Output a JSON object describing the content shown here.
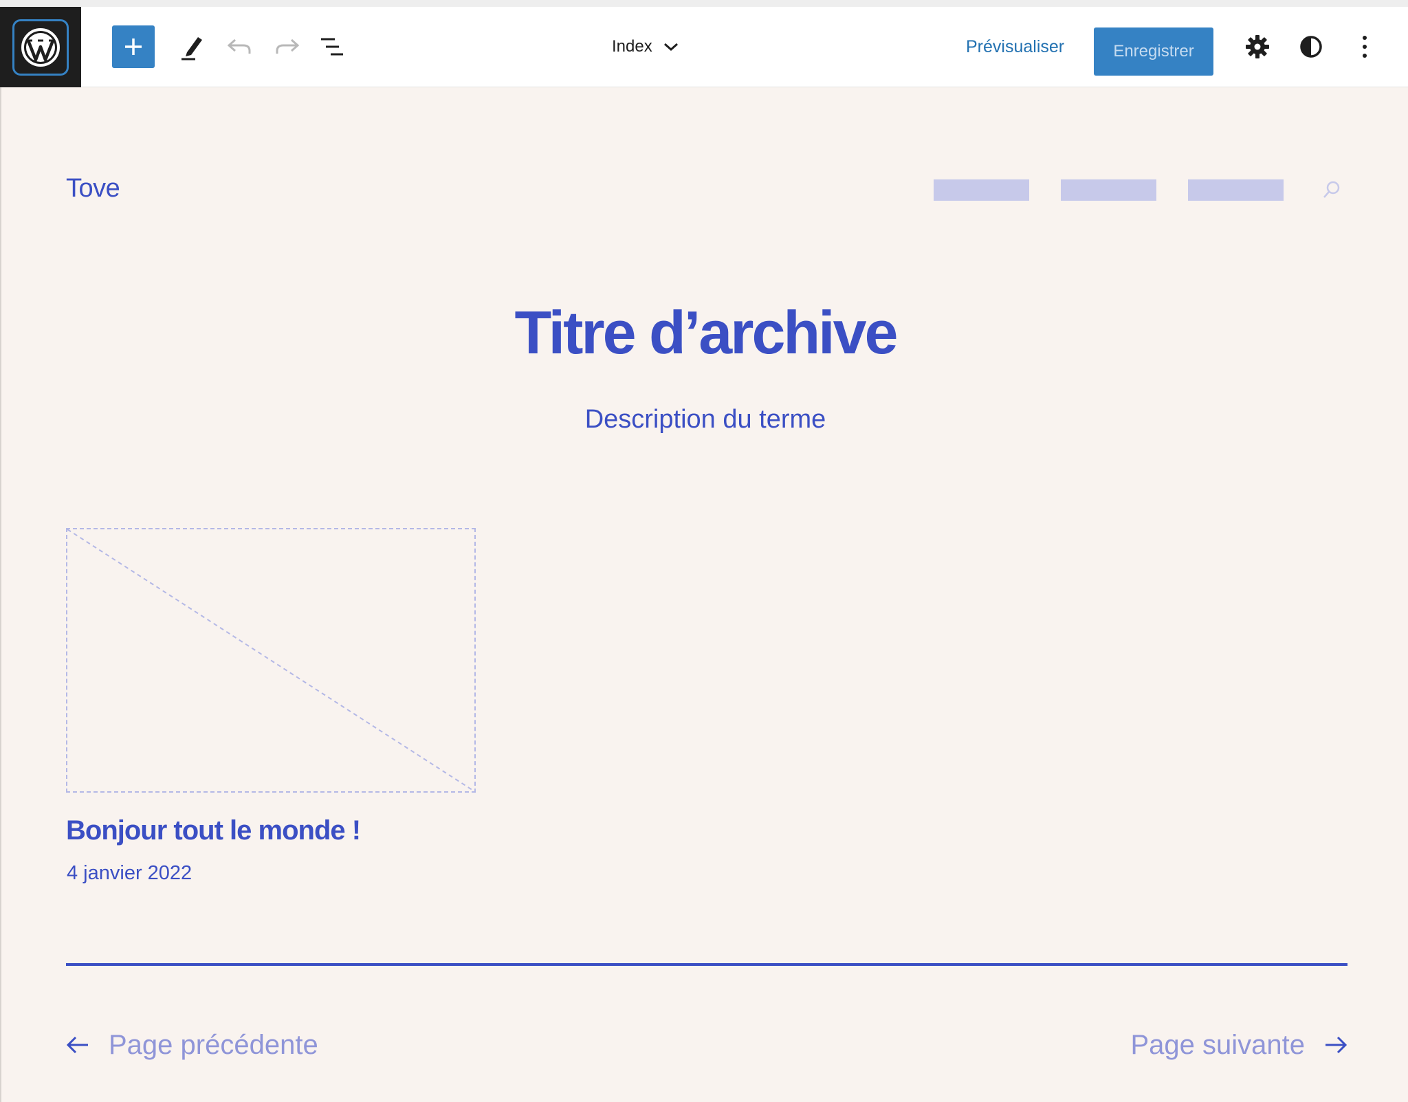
{
  "toolbar": {
    "logo_icon": "wordpress-logo-icon",
    "add_icon": "plus-icon",
    "edit_icon": "pencil-icon",
    "undo_icon": "undo-icon",
    "redo_icon": "redo-icon",
    "list_view_icon": "list-view-icon",
    "template_name": "Index",
    "preview_label": "Prévisualiser",
    "save_label": "Enregistrer",
    "settings_icon": "gear-icon",
    "styles_icon": "half-circle-icon",
    "options_icon": "vertical-dots-icon",
    "colors": {
      "accent": "#3582c4",
      "link": "#2271b1",
      "dark": "#1e1e1e"
    }
  },
  "canvas": {
    "site_title": "Tove",
    "nav_placeholders": 3,
    "search_icon": "search-icon",
    "archive_title": "Titre d’archive",
    "term_description": "Description du terme",
    "post": {
      "title": "Bonjour tout le monde !",
      "date": "4 janvier 2022"
    },
    "pagination": {
      "previous_label": "Page précédente",
      "next_label": "Page suivante"
    },
    "colors": {
      "background": "#f9f3ef",
      "primary": "#3b4fc4",
      "muted": "#8f95d8",
      "placeholder": "#c7c9ea"
    }
  }
}
